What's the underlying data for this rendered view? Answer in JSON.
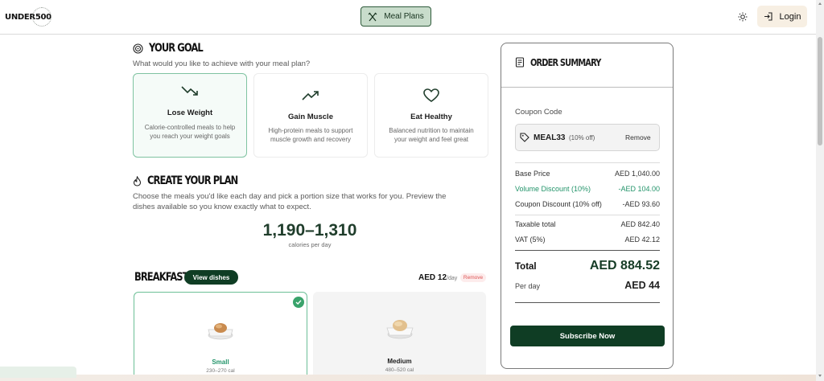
{
  "header": {
    "logo": "UNDER500",
    "nav_active": "Meal Plans",
    "login": "Login"
  },
  "goal": {
    "title": "YOUR GOAL",
    "subtitle": "What would you like to achieve with your meal plan?",
    "options": [
      {
        "title": "Lose Weight",
        "desc": "Calorie-controlled meals to help you reach your weight goals",
        "icon": "trending-down-icon",
        "selected": true
      },
      {
        "title": "Gain Muscle",
        "desc": "High-protein meals to support muscle growth and recovery",
        "icon": "trending-up-icon",
        "selected": false
      },
      {
        "title": "Eat Healthy",
        "desc": "Balanced nutrition to maintain your weight and feel great",
        "icon": "heart-icon",
        "selected": false
      }
    ]
  },
  "plan": {
    "title": "CREATE YOUR PLAN",
    "subtitle_line1": "Choose the meals you'd like each day and pick a portion size that works for you. Preview the",
    "subtitle_line2": "dishes available so you know exactly what to expect.",
    "calories": "1,190–1,310",
    "calories_label": "calories per day"
  },
  "breakfast": {
    "title": "BREAKFAST",
    "view_dishes": "View dishes",
    "price": "AED 12",
    "per_day": "/day",
    "remove": "Remove",
    "portions": [
      {
        "name": "Small",
        "cal": "230–270 cal",
        "selected": true
      },
      {
        "name": "Medium",
        "cal": "480–520 cal",
        "selected": false
      }
    ]
  },
  "summary": {
    "title": "ORDER SUMMARY",
    "coupon_label": "Coupon Code",
    "coupon_code": "MEAL33",
    "coupon_off": "(10% off)",
    "coupon_remove": "Remove",
    "base_price_label": "Base Price",
    "base_price": "AED 1,040.00",
    "volume_label": "Volume Discount (10%)",
    "volume_value": "-AED 104.00",
    "coupon_disc_label": "Coupon Discount (10% off)",
    "coupon_disc_value": "-AED 93.60",
    "taxable_label": "Taxable total",
    "taxable_value": "AED 842.40",
    "vat_label": "VAT (5%)",
    "vat_value": "AED 42.12",
    "total_label": "Total",
    "total_value": "AED 884.52",
    "perday_label": "Per day",
    "perday_value": "AED 44",
    "subscribe": "Subscribe Now"
  },
  "colors": {
    "brand_dark": "#0f3d24",
    "accent_green": "#23946a",
    "selected_border": "#7fc3a1"
  }
}
